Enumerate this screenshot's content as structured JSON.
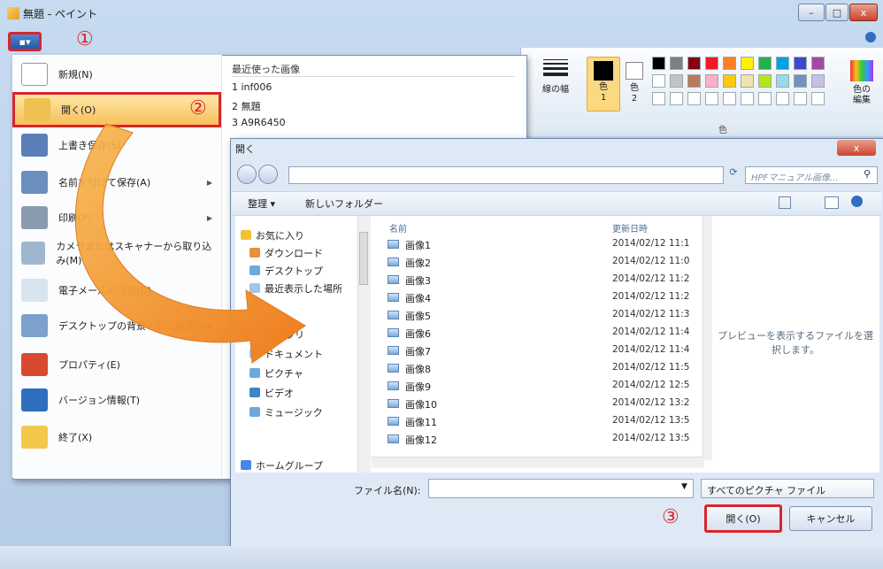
{
  "window": {
    "title": "無題 - ペイント",
    "minimize": "–",
    "maximize": "□",
    "close": "x"
  },
  "file_menu_button": {
    "label": "▪▾"
  },
  "steps": {
    "one": "①",
    "two": "②",
    "three": "③"
  },
  "file_menu": {
    "items": [
      {
        "label": "新規(N)"
      },
      {
        "label": "開く(O)"
      },
      {
        "label": "上書き保存(S)"
      },
      {
        "label": "名前を付けて保存(A)"
      },
      {
        "label": "印刷(P)"
      },
      {
        "label": "カメラまたはスキャナーから取り込み(M)"
      },
      {
        "label": "電子メールの送信(D)"
      },
      {
        "label": "デスクトップの背景として設定(B)"
      },
      {
        "label": "プロパティ(E)"
      },
      {
        "label": "バージョン情報(T)"
      },
      {
        "label": "終了(X)"
      }
    ],
    "recent_header": "最近使った画像",
    "recent": [
      "1 inf006",
      "2 無題",
      "3 A9R6450"
    ]
  },
  "ribbon": {
    "line_width": "線の幅",
    "color1": "色\n1",
    "color2": "色\n2",
    "edit_colors": "色の\n編集",
    "group_label": "色",
    "palette": [
      "#000000",
      "#7f7f7f",
      "#880015",
      "#ed1c24",
      "#ff7f27",
      "#fff200",
      "#22b14c",
      "#00a2e8",
      "#3f48cc",
      "#a349a4",
      "#ffffff",
      "#c3c3c3",
      "#b97a57",
      "#ffaec9",
      "#ffc90e",
      "#efe4b0",
      "#b5e61d",
      "#99d9ea",
      "#7092be",
      "#c8bfe7"
    ]
  },
  "dialog": {
    "title": "開く",
    "close": "x",
    "search_placeholder": "HPFマニュアル画像...",
    "search_icon": "⚲",
    "refresh": "⟳",
    "toolbar": {
      "organize": "整理 ▾",
      "new_folder": "新しいフォルダー"
    },
    "nav": [
      "お気に入り",
      "ダウンロード",
      "デスクトップ",
      "最近表示した場所",
      "ライブラリ",
      "ドキュメント",
      "ピクチャ",
      "ビデオ",
      "ミュージック",
      "ホームグループ"
    ],
    "columns": {
      "name": "名前",
      "date": "更新日時"
    },
    "files": [
      {
        "name": "画像1",
        "date": "2014/02/12 11:1"
      },
      {
        "name": "画像2",
        "date": "2014/02/12 11:0"
      },
      {
        "name": "画像3",
        "date": "2014/02/12 11:2"
      },
      {
        "name": "画像4",
        "date": "2014/02/12 11:2"
      },
      {
        "name": "画像5",
        "date": "2014/02/12 11:3"
      },
      {
        "name": "画像6",
        "date": "2014/02/12 11:4"
      },
      {
        "name": "画像7",
        "date": "2014/02/12 11:4"
      },
      {
        "name": "画像8",
        "date": "2014/02/12 11:5"
      },
      {
        "name": "画像9",
        "date": "2014/02/12 12:5"
      },
      {
        "name": "画像10",
        "date": "2014/02/12 13:2"
      },
      {
        "name": "画像11",
        "date": "2014/02/12 13:5"
      },
      {
        "name": "画像12",
        "date": "2014/02/12 13:5"
      }
    ],
    "preview": "プレビューを表示するファイルを選択します。",
    "filename_label": "ファイル名(N):",
    "filter": "すべてのピクチャ ファイル",
    "open": "開く(O)",
    "cancel": "キャンセル"
  }
}
